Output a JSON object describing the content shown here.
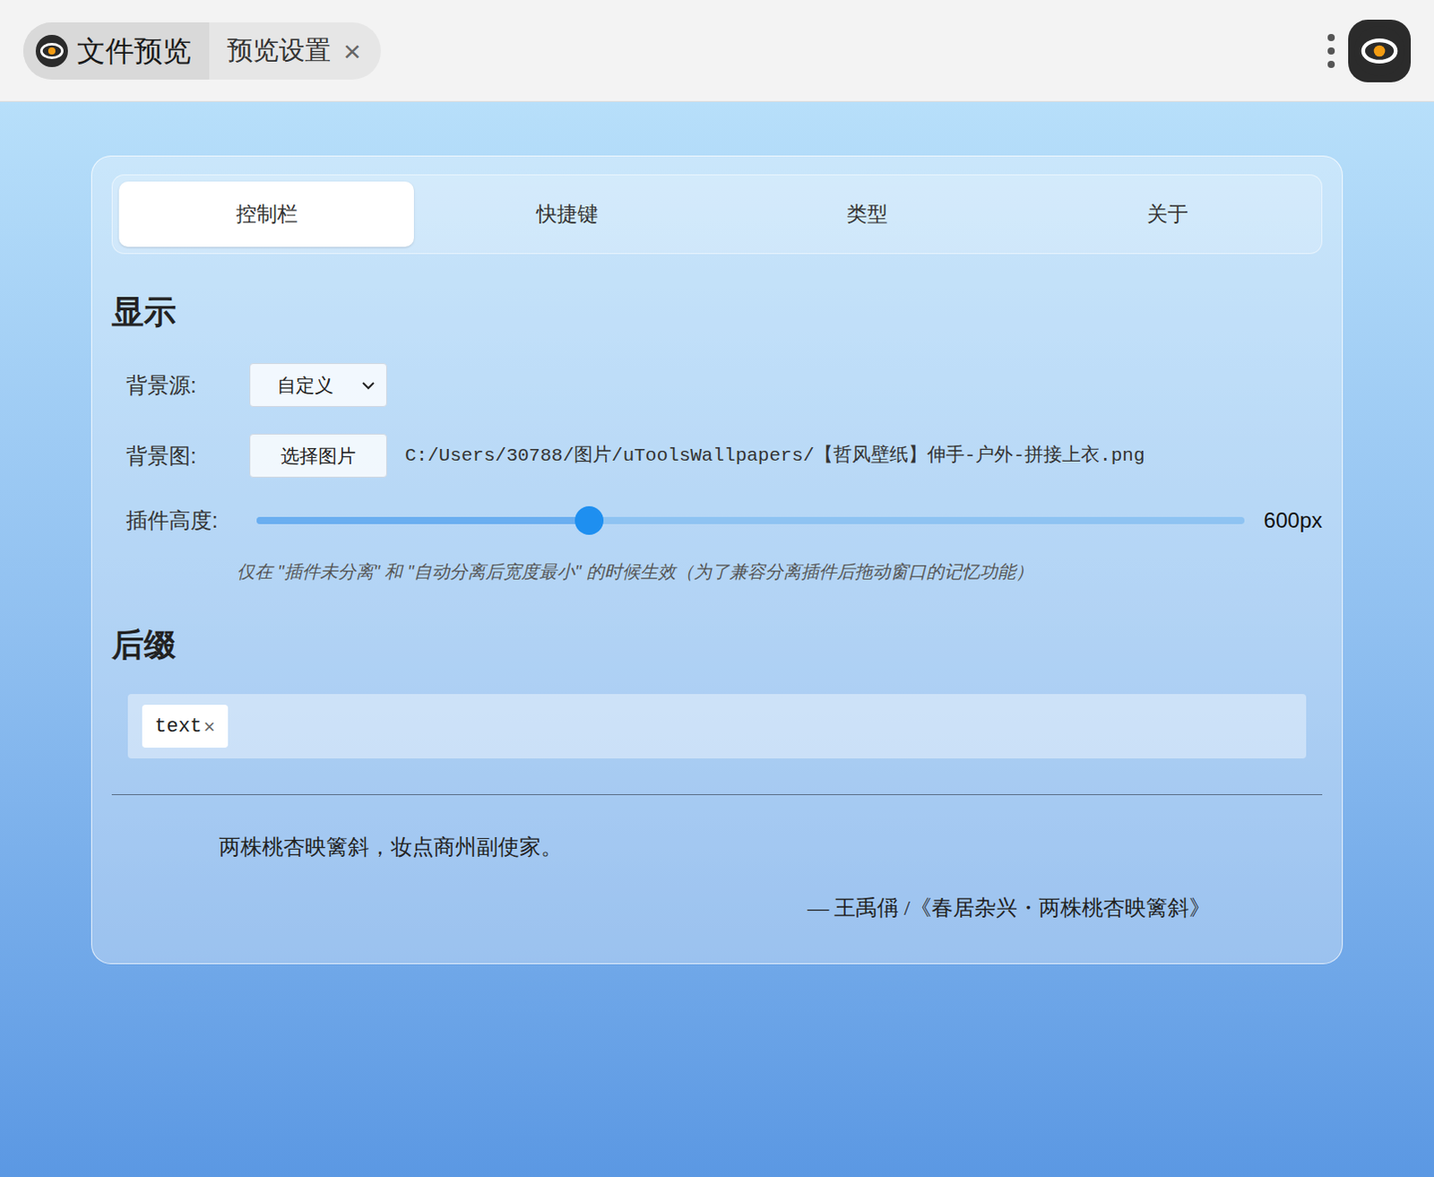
{
  "window": {
    "plugin": "文件预览",
    "page": "预览设置",
    "close": "×"
  },
  "settings_tabs": [
    {
      "label": "控制栏",
      "selected": true
    },
    {
      "label": "快捷键",
      "selected": false
    },
    {
      "label": "类型",
      "selected": false
    },
    {
      "label": "关于",
      "selected": false
    }
  ],
  "display": {
    "title": "显示",
    "background_source": {
      "label": "背景源:",
      "value": "自定义"
    },
    "background_image": {
      "label": "背景图:",
      "button": "选择图片",
      "path": "C:/Users/30788/图片/uToolsWallpapers/【哲风壁纸】伸手-户外-拼接上衣.png"
    },
    "plugin_height": {
      "label": "插件高度:",
      "level": 0.337,
      "reading": "600px"
    },
    "hint": "仅在 \"插件未分离\" 和 \"自动分离后宽度最小\" 的时候生效（为了兼容分离插件后拖动窗口的记忆功能）"
  },
  "suffix": {
    "title": "后缀",
    "tags": [
      {
        "label": "text",
        "remove": "×"
      }
    ]
  },
  "quote": {
    "text": "两株桃杏映篱斜，妆点商州副使家。",
    "source": "— 王禹偁 /《春居杂兴・两株桃杏映篱斜》"
  }
}
